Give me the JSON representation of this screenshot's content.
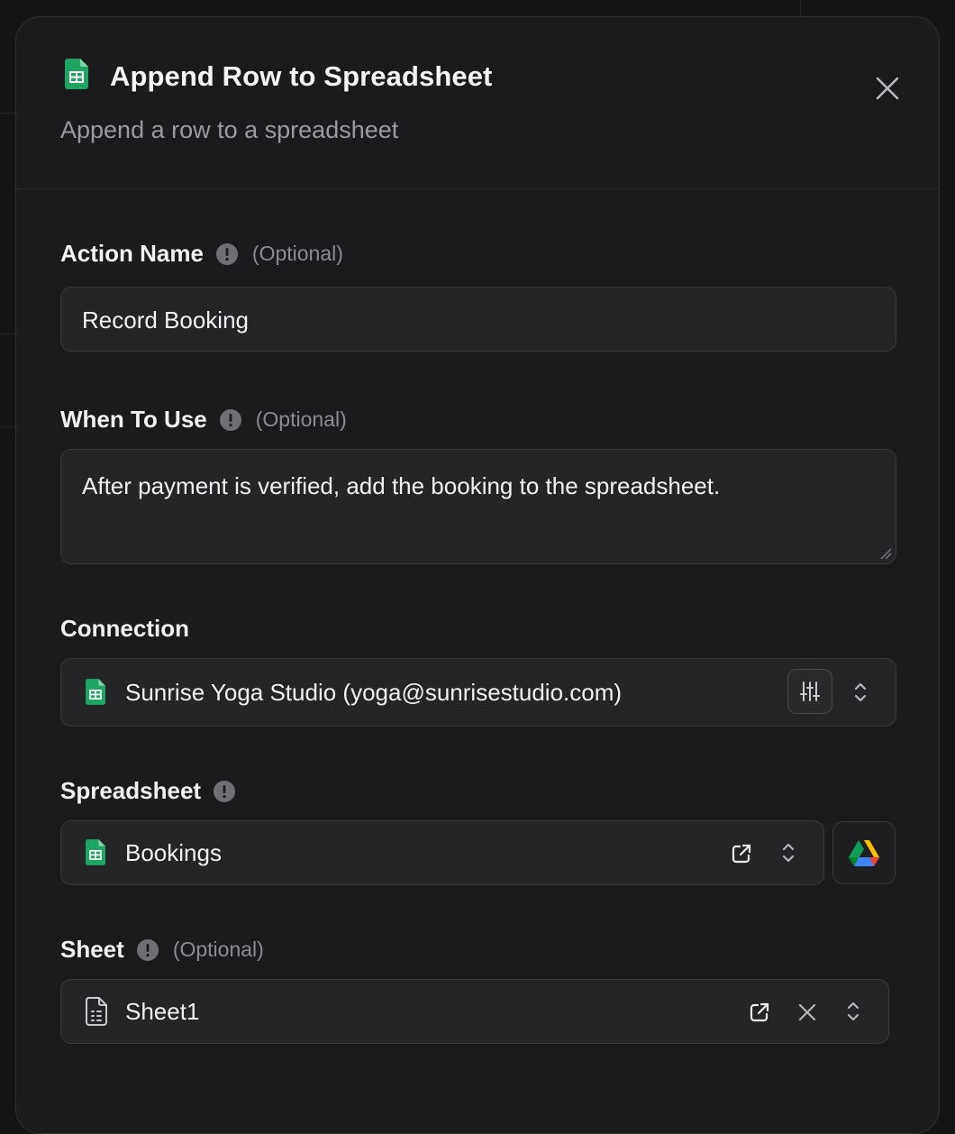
{
  "modal": {
    "title": "Append Row to Spreadsheet",
    "subtitle": "Append a row to a spreadsheet"
  },
  "fields": {
    "action_name": {
      "label": "Action Name",
      "optional": "(Optional)",
      "value": "Record Booking"
    },
    "when_to_use": {
      "label": "When To Use",
      "optional": "(Optional)",
      "value": "After payment is verified, add the booking to the spreadsheet."
    },
    "connection": {
      "label": "Connection",
      "value": "Sunrise Yoga Studio (yoga@sunrisestudio.com)"
    },
    "spreadsheet": {
      "label": "Spreadsheet",
      "value": "Bookings"
    },
    "sheet": {
      "label": "Sheet",
      "optional": "(Optional)",
      "value": "Sheet1"
    }
  },
  "icons": {
    "sheets": "google-sheets-icon",
    "close": "close-icon",
    "info": "info-icon",
    "adjust": "sliders-icon",
    "chevrons": "chevron-up-down-icon",
    "external": "external-link-icon",
    "drive": "google-drive-icon",
    "sheet_file": "sheet-file-icon",
    "clear": "clear-icon"
  },
  "colors": {
    "background": "#141416",
    "modal": "#1b1b1d",
    "input": "#252528",
    "sheets_green": "#1fa463"
  }
}
